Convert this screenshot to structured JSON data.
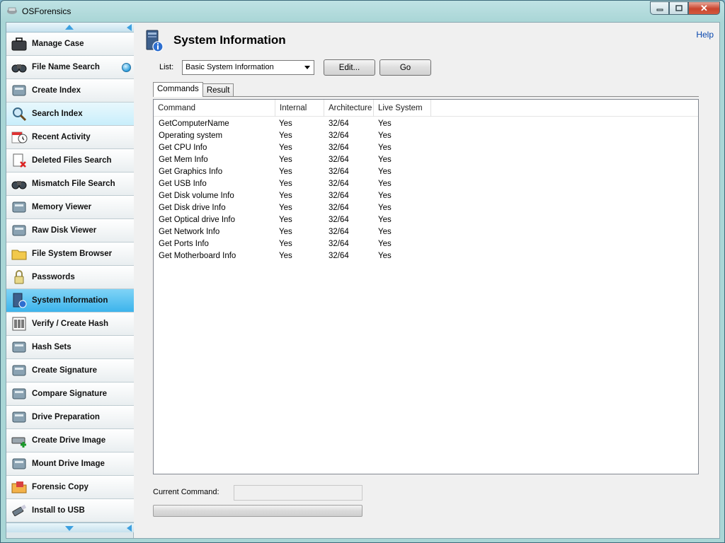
{
  "window": {
    "title": "OSForensics",
    "controls": {
      "minimize": "▭",
      "maximize": "◻",
      "close": "✕"
    }
  },
  "sidebar": {
    "items": [
      {
        "label": "Manage Case",
        "icon": "briefcase-icon",
        "state": "normal"
      },
      {
        "label": "File Name Search",
        "icon": "binoculars-icon",
        "state": "normal",
        "badge": "search-orb"
      },
      {
        "label": "Create Index",
        "icon": "index-book-icon",
        "state": "normal"
      },
      {
        "label": "Search Index",
        "icon": "magnifier-icon",
        "state": "hover"
      },
      {
        "label": "Recent Activity",
        "icon": "calendar-clock-icon",
        "state": "normal"
      },
      {
        "label": "Deleted Files Search",
        "icon": "deleted-file-icon",
        "state": "normal"
      },
      {
        "label": "Mismatch File Search",
        "icon": "binoculars-icon",
        "state": "normal"
      },
      {
        "label": "Memory Viewer",
        "icon": "memory-chip-icon",
        "state": "normal"
      },
      {
        "label": "Raw Disk Viewer",
        "icon": "disk-icon",
        "state": "normal"
      },
      {
        "label": "File System Browser",
        "icon": "folder-icon",
        "state": "normal"
      },
      {
        "label": "Passwords",
        "icon": "padlock-icon",
        "state": "normal"
      },
      {
        "label": "System Information",
        "icon": "computer-info-icon",
        "state": "selected"
      },
      {
        "label": "Verify / Create Hash",
        "icon": "barcode-icon",
        "state": "normal"
      },
      {
        "label": "Hash Sets",
        "icon": "hash-sets-icon",
        "state": "normal"
      },
      {
        "label": "Create Signature",
        "icon": "signature-icon",
        "state": "normal"
      },
      {
        "label": "Compare Signature",
        "icon": "compare-signature-icon",
        "state": "normal"
      },
      {
        "label": "Drive Preparation",
        "icon": "drive-icon",
        "state": "normal"
      },
      {
        "label": "Create Drive Image",
        "icon": "drive-add-icon",
        "state": "normal"
      },
      {
        "label": "Mount Drive Image",
        "icon": "drive-mount-icon",
        "state": "normal"
      },
      {
        "label": "Forensic Copy",
        "icon": "folder-copy-icon",
        "state": "normal"
      },
      {
        "label": "Install to USB",
        "icon": "usb-icon",
        "state": "normal"
      }
    ]
  },
  "main": {
    "title": "System Information",
    "help": "Help",
    "list_label": "List:",
    "list_selected": "Basic System Information",
    "edit_button": "Edit...",
    "go_button": "Go",
    "tabs": [
      {
        "label": "Commands",
        "active": true
      },
      {
        "label": "Result",
        "active": false
      }
    ],
    "columns": [
      "Command",
      "Internal",
      "Architecture",
      "Live System"
    ],
    "rows": [
      [
        "GetComputerName",
        "Yes",
        "32/64",
        "Yes"
      ],
      [
        "Operating system",
        "Yes",
        "32/64",
        "Yes"
      ],
      [
        "Get CPU Info",
        "Yes",
        "32/64",
        "Yes"
      ],
      [
        "Get Mem Info",
        "Yes",
        "32/64",
        "Yes"
      ],
      [
        "Get Graphics Info",
        "Yes",
        "32/64",
        "Yes"
      ],
      [
        "Get USB Info",
        "Yes",
        "32/64",
        "Yes"
      ],
      [
        "Get Disk volume Info",
        "Yes",
        "32/64",
        "Yes"
      ],
      [
        "Get Disk drive Info",
        "Yes",
        "32/64",
        "Yes"
      ],
      [
        "Get Optical drive Info",
        "Yes",
        "32/64",
        "Yes"
      ],
      [
        "Get Network Info",
        "Yes",
        "32/64",
        "Yes"
      ],
      [
        "Get Ports Info",
        "Yes",
        "32/64",
        "Yes"
      ],
      [
        "Get Motherboard Info",
        "Yes",
        "32/64",
        "Yes"
      ]
    ],
    "current_command_label": "Current Command:",
    "current_command_value": "",
    "progress": 0
  },
  "colors": {
    "selected_item": "#3db4ec",
    "hover_item": "#c9eefb",
    "scroll_arrow": "#3da0e0",
    "close_button": "#c9452e",
    "help_link": "#0645ad"
  }
}
